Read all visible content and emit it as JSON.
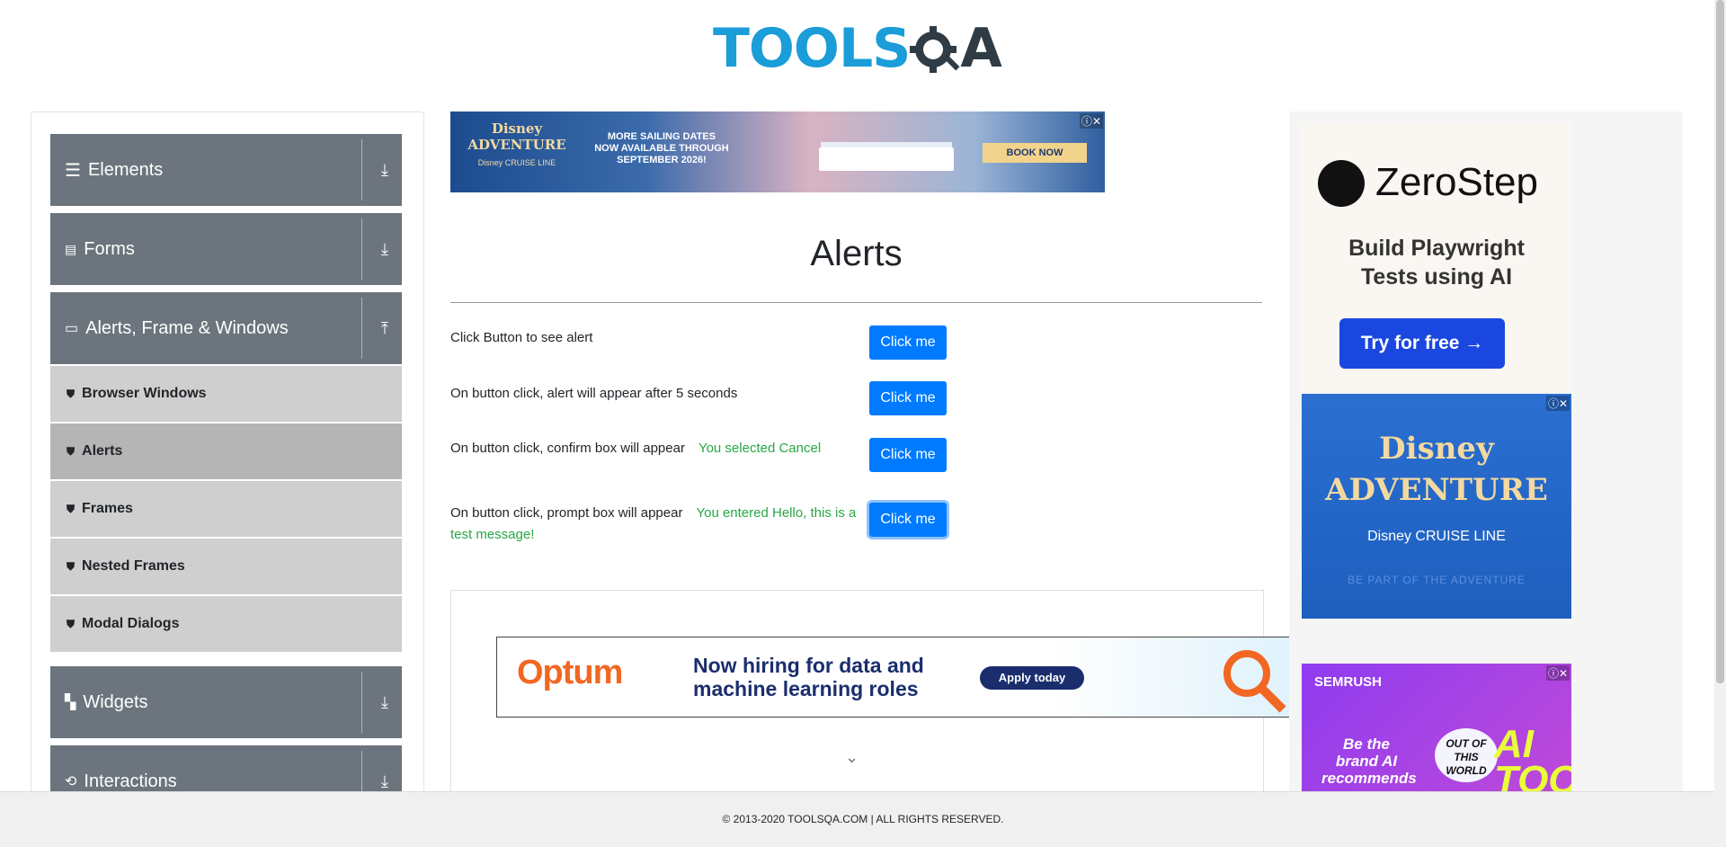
{
  "header": {
    "logo_part1": "TOOLS",
    "logo_part2": "A"
  },
  "sidebar": {
    "groups": [
      {
        "label": "Elements",
        "icon": "menu-icon",
        "state": "collapsed"
      },
      {
        "label": "Forms",
        "icon": "form-icon",
        "state": "collapsed"
      },
      {
        "label": "Alerts, Frame & Windows",
        "icon": "window-icon",
        "state": "expanded"
      },
      {
        "label": "Widgets",
        "icon": "widgets-icon",
        "state": "collapsed"
      },
      {
        "label": "Interactions",
        "icon": "interactions-icon",
        "state": "collapsed"
      }
    ],
    "items": [
      {
        "label": "Browser Windows"
      },
      {
        "label": "Alerts",
        "active": true
      },
      {
        "label": "Frames"
      },
      {
        "label": "Nested Frames"
      },
      {
        "label": "Modal Dialogs"
      }
    ]
  },
  "ads": {
    "top_banner": {
      "brand": "Disney ADVENTURE",
      "sub": "Disney CRUISE LINE",
      "text": "MORE SAILING DATES NOW AVAILABLE THROUGH SEPTEMBER 2026!",
      "cta": "BOOK NOW"
    },
    "optum": {
      "brand": "Optum",
      "text": "Now hiring for data and machine learning roles",
      "cta": "Apply today"
    },
    "zerostep": {
      "brand": "ZeroStep",
      "text": "Build Playwright Tests using AI",
      "cta": "Try for free →"
    },
    "disney_right": {
      "brand": "Disney ADVENTURE",
      "sub": "Disney CRUISE LINE",
      "tagline": "BE PART OF THE ADVENTURE"
    },
    "semrush": {
      "brand": "SEMRUSH",
      "text": "Be the brand AI recommends",
      "badge": "OUT OF THIS WORLD",
      "big": "AI TOOLKIT"
    }
  },
  "main": {
    "title": "Alerts",
    "rows": [
      {
        "text": "Click Button to see alert",
        "result": "",
        "button": "Click me"
      },
      {
        "text": "On button click, alert will appear after 5 seconds",
        "result": "",
        "button": "Click me"
      },
      {
        "text": "On button click, confirm box will appear",
        "result": "You selected Cancel",
        "button": "Click me"
      },
      {
        "text": "On button click, prompt box will appear",
        "result": "You entered Hello, this is a test message!",
        "button": "Click me"
      }
    ]
  },
  "footer": {
    "text": "© 2013-2020 TOOLSQA.COM | ALL RIGHTS RESERVED."
  },
  "colors": {
    "primary": "#007bff",
    "sidebar_group": "#6c757d",
    "sidebar_item": "#cfcfcf",
    "success": "#28a745",
    "logo_blue": "#1a9dd9"
  }
}
